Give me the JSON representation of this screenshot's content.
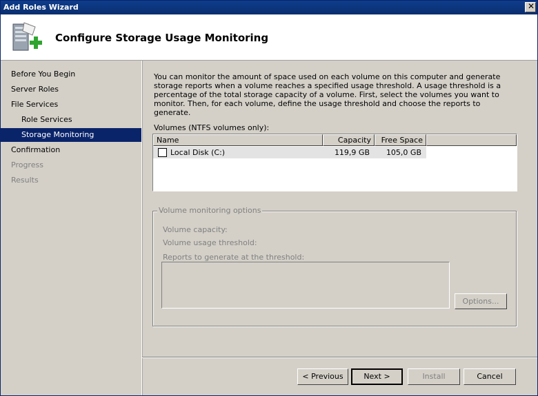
{
  "window": {
    "title": "Add Roles Wizard"
  },
  "header": {
    "title": "Configure Storage Usage Monitoring"
  },
  "nav": {
    "items": [
      {
        "label": "Before You Begin",
        "state": "normal"
      },
      {
        "label": "Server Roles",
        "state": "normal"
      },
      {
        "label": "File Services",
        "state": "normal"
      },
      {
        "label": "Role Services",
        "state": "normal",
        "sub": true
      },
      {
        "label": "Storage Monitoring",
        "state": "active",
        "sub": true
      },
      {
        "label": "Confirmation",
        "state": "normal"
      },
      {
        "label": "Progress",
        "state": "disabled"
      },
      {
        "label": "Results",
        "state": "disabled"
      }
    ]
  },
  "content": {
    "intro": "You can monitor the amount of space used on each volume on this computer and generate storage reports when a volume reaches a specified usage threshold.  A usage threshold is a percentage of the total storage capacity of a volume. First, select the volumes you want to monitor.  Then, for each volume, define the usage threshold and choose the reports to generate.",
    "volumes_label": "Volumes (NTFS volumes only):",
    "columns": {
      "name": "Name",
      "capacity": "Capacity",
      "free": "Free Space"
    },
    "rows": [
      {
        "name": "Local Disk (C:)",
        "capacity": "119,9 GB",
        "free": "105,0 GB",
        "checked": false
      }
    ],
    "group": {
      "legend": "Volume monitoring options",
      "capacity_label": "Volume capacity:",
      "threshold_label": "Volume usage threshold:",
      "reports_label": "Reports to generate at the threshold:",
      "options_button": "Options..."
    }
  },
  "footer": {
    "previous": "< Previous",
    "next": "Next >",
    "install": "Install",
    "cancel": "Cancel"
  }
}
